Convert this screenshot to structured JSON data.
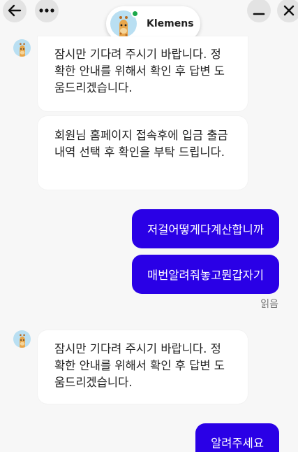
{
  "header": {
    "agent_name": "Klemens",
    "back_icon": "arrow-left-icon",
    "more_icon": "more-dots-icon",
    "minimize_icon": "minimize-icon",
    "close_icon": "close-icon",
    "online_color": "#1aa84a"
  },
  "messages": [
    {
      "from": "agent",
      "text": "잠시만 기다려 주시기 바랍니다. 정확한 안내를 위해서 확인 후 답변 도움드리겠습니다."
    },
    {
      "from": "agent",
      "text": "회원님 홈페이지 접속후에 입금 출금내역 선택 후 확인을 부탁 드립니다."
    },
    {
      "from": "user",
      "text": "저걸어떻게다계산합니까"
    },
    {
      "from": "user",
      "text": "매번알려줘놓고뭔갑자기"
    },
    {
      "from": "agent",
      "text": "잠시만 기다려 주시기 바랍니다. 정확한 안내를 위해서 확인 후 답변 도움드리겠습니다."
    },
    {
      "from": "user",
      "text": "알려주세요"
    }
  ],
  "read_label": "읽음",
  "colors": {
    "user_bubble": "#2a00e6",
    "agent_bubble": "#ffffff",
    "background": "#f7f7f7"
  }
}
